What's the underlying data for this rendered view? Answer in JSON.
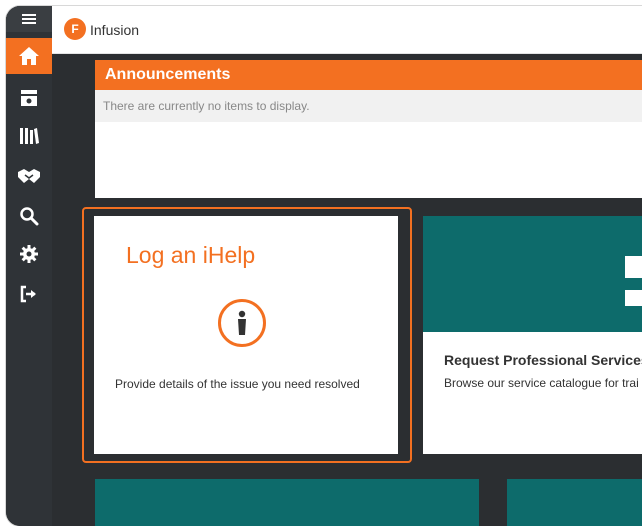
{
  "app": {
    "title": "Infusion",
    "logo_text": "F"
  },
  "sidebar": {
    "items": [
      {
        "name": "menu",
        "icon": "hamburger-icon"
      },
      {
        "name": "home",
        "icon": "home-icon",
        "active": true
      },
      {
        "name": "inbox",
        "icon": "inbox-icon"
      },
      {
        "name": "library",
        "icon": "books-icon"
      },
      {
        "name": "handshake",
        "icon": "handshake-icon"
      },
      {
        "name": "search",
        "icon": "search-icon"
      },
      {
        "name": "settings",
        "icon": "gear-icon"
      },
      {
        "name": "logout",
        "icon": "logout-icon"
      }
    ]
  },
  "announcements": {
    "title": "Announcements",
    "empty_text": "There are currently no items to display."
  },
  "cards": {
    "ihelp": {
      "title": "Log an iHelp",
      "description": "Provide details of the issue you need resolved",
      "icon": "info-icon"
    },
    "services": {
      "title": "Request Professional Services",
      "description": "Browse our service catalogue for trai"
    }
  },
  "colors": {
    "accent": "#f37021",
    "teal": "#0d6b6b",
    "sidebar": "#2f3337",
    "background": "#2b2e31"
  }
}
